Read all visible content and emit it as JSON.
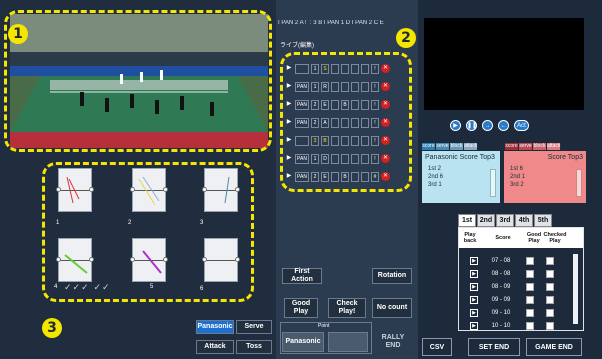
{
  "header": {
    "status_text": "I PAN 2 A !  : 3 B I PAN 1 D I PAN 2 C E"
  },
  "annotations": [
    "1",
    "2",
    "3"
  ],
  "rally": {
    "title": "ライブ(編集)",
    "rows": [
      {
        "team": "",
        "num": "1",
        "code": "S",
        "end": "!"
      },
      {
        "team": "PAN",
        "num": "1",
        "code": "R",
        "end": "!"
      },
      {
        "team": "PAN",
        "num": "2",
        "code": "E",
        "code2": "B",
        "end": "!"
      },
      {
        "team": "PAN",
        "num": "2",
        "code": "A",
        "end": "!"
      },
      {
        "team": "",
        "num": "3",
        "code": "B",
        "end": "!"
      },
      {
        "team": "PAN",
        "num": "1",
        "code": "D",
        "end": "!"
      },
      {
        "team": "PAN",
        "num": "2",
        "code": "E",
        "code2": "B",
        "end": "#"
      }
    ],
    "play_glyph": "▶",
    "delete_glyph": "✕"
  },
  "courts": {
    "labels": [
      "1",
      "2",
      "3",
      "4",
      "5",
      "6"
    ],
    "arrows_text": "✓✓✓ ✓✓"
  },
  "team_buttons": {
    "panasonic": "Panasonic",
    "serve": "Serve",
    "attack": "Attack",
    "toss": "Toss"
  },
  "actions": {
    "first_action": "First Action",
    "rotation": "Rotation",
    "good_play": "Good\nPlay",
    "check_play": "Check\nPlay!",
    "no_count": "No count",
    "point_label": "Point",
    "point_panasonic": "Panasonic",
    "point_opponent": "",
    "rally_end": "RALLY\nEND"
  },
  "player_controls": {
    "act_label": "Act"
  },
  "score_tabs": {
    "left": [
      "score",
      "serve",
      "block",
      "attack"
    ],
    "right": [
      "score",
      "serve",
      "block",
      "attack"
    ]
  },
  "panasonic_top3": {
    "title": "Panasonic Score Top3",
    "rows": [
      "1st  2",
      "2nd  6",
      "3rd  1"
    ]
  },
  "opponent_top3": {
    "title": "Score Top3",
    "rows": [
      "1st  6",
      "2nd  1",
      "3rd  2"
    ]
  },
  "set_tabs": [
    "1st",
    "2nd",
    "3rd",
    "4th",
    "5th"
  ],
  "history": {
    "headers": [
      "Play back",
      "Score",
      "Good Play",
      "Checked Play"
    ],
    "rows": [
      "07 - 08",
      "08 - 08",
      "08 - 09",
      "09 - 09",
      "09 - 10",
      "10 - 10"
    ]
  },
  "footer": {
    "csv": "CSV",
    "set_end": "SET END",
    "game_end": "GAME END"
  },
  "colors": {
    "accent_yellow": "#f5e600",
    "panasonic_blue": "#1d6fd0",
    "delete_red": "#d32020",
    "opponent_pink": "#f08a8a",
    "panasonic_box": "#b9e3f0"
  }
}
